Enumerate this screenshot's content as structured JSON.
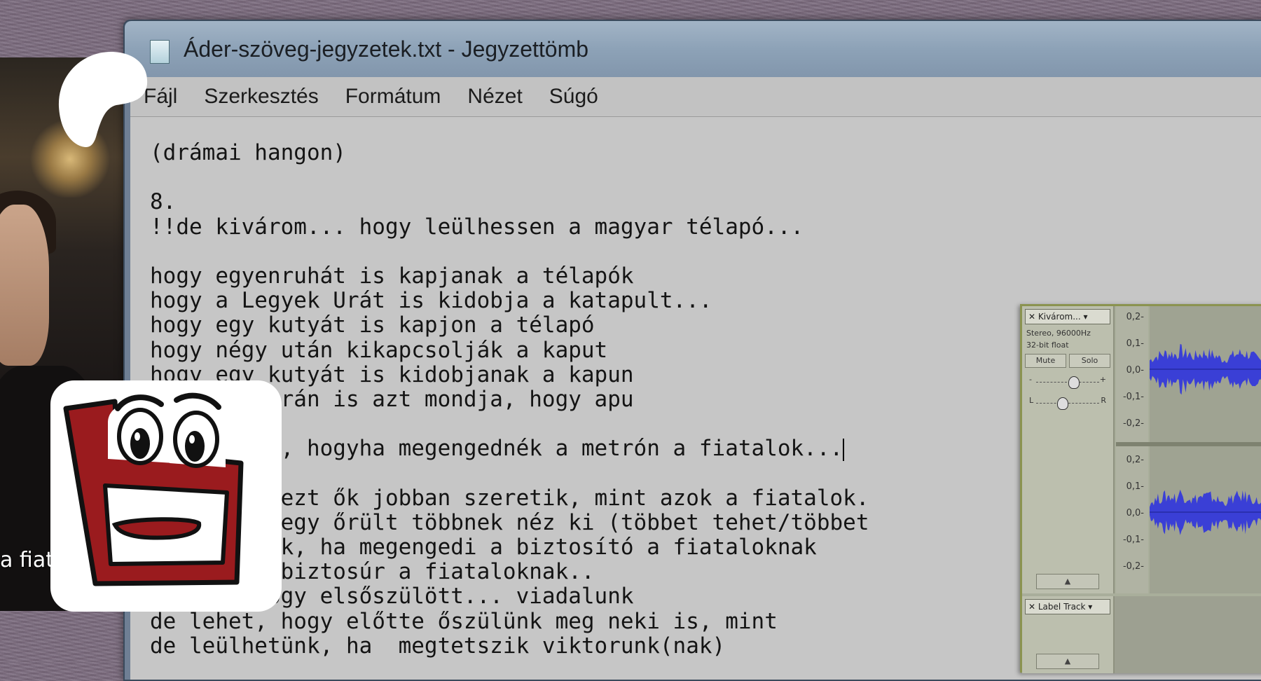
{
  "video": {
    "subtitle": "a fiat"
  },
  "window": {
    "title": "Áder-szöveg-jegyzetek.txt - Jegyzettömb"
  },
  "menu": {
    "items": [
      "Fájl",
      "Szerkesztés",
      "Formátum",
      "Nézet",
      "Súgó"
    ]
  },
  "editor": {
    "lines": [
      "(drámai hangon)",
      "",
      "8.",
      "!!de kivárom... hogy leülhessen a magyar télapó...",
      "",
      "hogy egyenruhát is kapjanak a télapók",
      "hogy a Legyek Urát is kidobja a katapult...",
      "hogy egy kutyát is kapjon a télapó",
      "hogy négy után kikapcsolják a kaput",
      "hogy egy kutyát is kidobjanak a kapun",
      "      y ukrán is azt mondja, hogy apu",
      "",
      "     he) ő, hogyha megengednék a metrón a fiatalok...",
      "",
      "      ogy ezt ők jobban szeretik, mint azok a fiatalok.",
      "      ogy egy őrült többnek néz ki (többet tehet/többet",
      "      etünk, ha megengedi a biztosító a fiataloknak",
      "      k a biztosúr a fiataloknak..",
      "      , hogy elsőszülött... viadalunk",
      "de lehet, hogy előtte őszülünk meg neki is, mint",
      "de leülhetünk, ha  megtetszik viktorunk(nak)"
    ],
    "caret_line": 12
  },
  "audacity": {
    "track_name": "Kivárom...",
    "format_line1": "Stereo, 96000Hz",
    "format_line2": "32-bit float",
    "mute_label": "Mute",
    "solo_label": "Solo",
    "gain_minus": "-",
    "gain_plus": "+",
    "pan_left": "L",
    "pan_right": "R",
    "ruler_ticks": [
      "0,2-",
      "0,1-",
      "0,0-",
      "-0,1-",
      "-0,2-"
    ],
    "label_track_name": "Label Track",
    "wave_color": "#3a3fd6"
  }
}
